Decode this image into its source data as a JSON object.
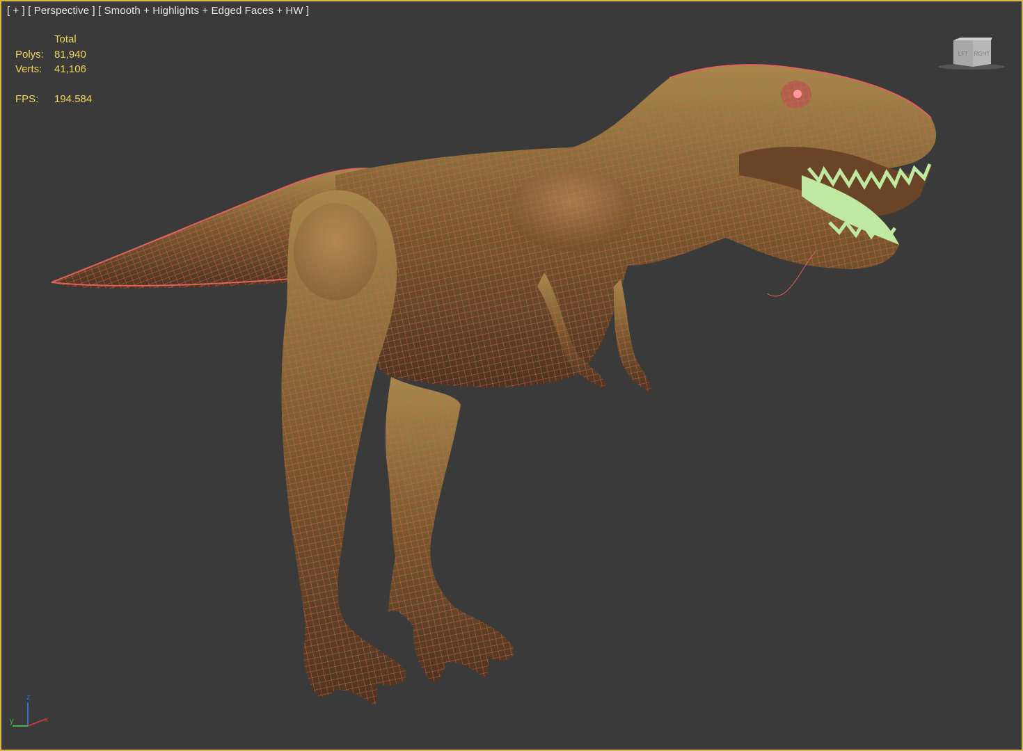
{
  "viewport": {
    "label_plus": "[ + ]",
    "label_view": "[ Perspective ]",
    "label_shading": "[ Smooth + Highlights + Edged Faces + HW ]",
    "border_color": "#d6b94a",
    "background_color": "#3a3a3a"
  },
  "stats": {
    "header": "Total",
    "polys_label": "Polys:",
    "polys_value": "81,940",
    "verts_label": "Verts:",
    "verts_value": "41,106",
    "fps_label": "FPS:",
    "fps_value": "194.584",
    "color": "#f2d75a"
  },
  "viewcube": {
    "left_face": "LFT",
    "right_face": "RGHT"
  },
  "axis": {
    "z": "z",
    "y": "y",
    "x": "x"
  },
  "model": {
    "icon": "t-rex-wireframe-model",
    "wire_color": "#e0625e",
    "teeth_color": "#bfe8a0"
  }
}
